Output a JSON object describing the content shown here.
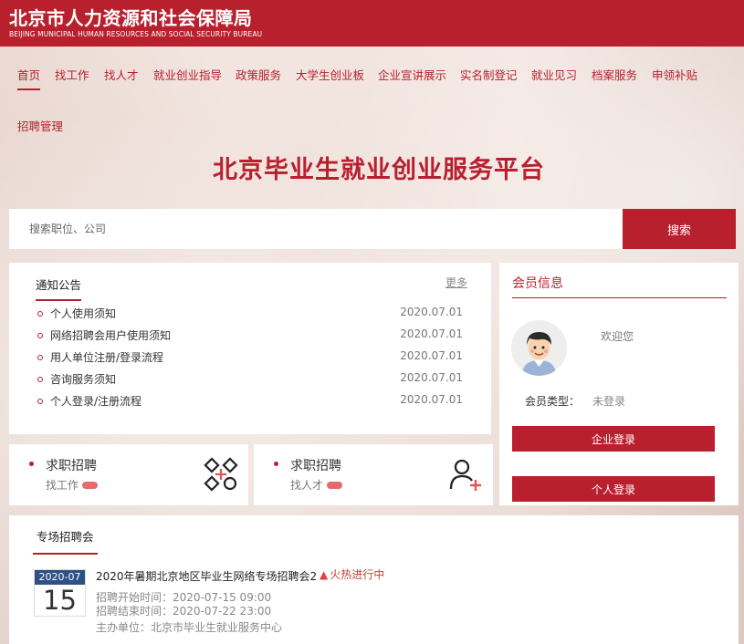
{
  "header": {
    "title_cn": "北京市人力资源和社会保障局",
    "title_en": "BEIJING MUNICIPAL HUMAN RESOURCES AND SOCIAL SECURITY BUREAU"
  },
  "nav": {
    "items": [
      "首页",
      "找工作",
      "找人才",
      "就业创业指导",
      "政策服务",
      "大学生创业板",
      "企业宣讲展示",
      "实名制登记",
      "就业见习",
      "档案服务",
      "申领补贴",
      "招聘管理"
    ],
    "active": "首页"
  },
  "page": {
    "title": "北京毕业生就业创业服务平台"
  },
  "search": {
    "placeholder": "搜索职位、公司",
    "button": "搜索"
  },
  "notice": {
    "title": "通知公告",
    "more": "更多",
    "items": [
      {
        "text": "个人使用须知",
        "date": "2020.07.01"
      },
      {
        "text": "网络招聘会用户使用须知",
        "date": "2020.07.01"
      },
      {
        "text": "用人单位注册/登录流程",
        "date": "2020.07.01"
      },
      {
        "text": "咨询服务须知",
        "date": "2020.07.01"
      },
      {
        "text": "个人登录/注册流程",
        "date": "2020.07.01"
      }
    ]
  },
  "member": {
    "title": "会员信息",
    "welcome": "欢迎您",
    "type_label": "会员类型：",
    "type_value": "未登录",
    "enterprise_login": "企业登录",
    "personal_login": "个人登录"
  },
  "shortcuts": [
    {
      "title": "求职招聘",
      "sub": "找工作",
      "icon": "grid-diamonds-icon"
    },
    {
      "title": "求职招聘",
      "sub": "找人才",
      "icon": "add-person-icon"
    }
  ],
  "fair": {
    "title": "专场招聘会",
    "calendar_month": "2020-07",
    "calendar_day": "15",
    "name": "2020年暑期北京地区毕业生网络专场招聘会2",
    "status": "火热进行中",
    "start": "招聘开始时间：2020-07-15 09:00",
    "end": "招聘结束时间：2020-07-22 23:00",
    "organizer": "主办单位：北京市毕业生就业服务中心"
  },
  "colors": {
    "brand": "#b8202e",
    "calendar": "#2d5087"
  }
}
